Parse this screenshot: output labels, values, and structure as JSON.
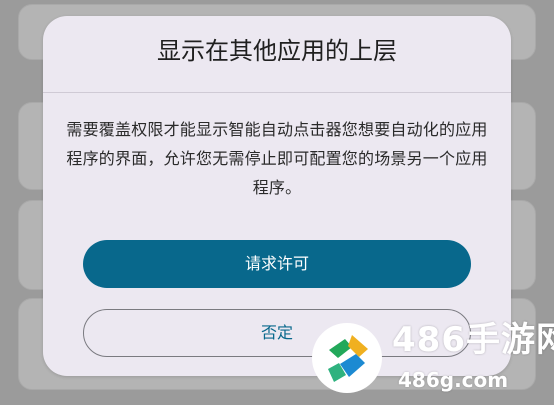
{
  "dialog": {
    "title": "显示在其他应用的上层",
    "message": "需要覆盖权限才能显示智能自动点击器您想要自动化的应用程序的界面，允许您无需停止即可配置您的场景另一个应用程序。",
    "primary_button": "请求许可",
    "secondary_button": "否定"
  },
  "watermark": {
    "brand": "486手游网",
    "url": "486g.com"
  },
  "colors": {
    "primary": "#08688c",
    "dialog_bg": "#ece8f1",
    "scrim": "#9b9b9b"
  }
}
